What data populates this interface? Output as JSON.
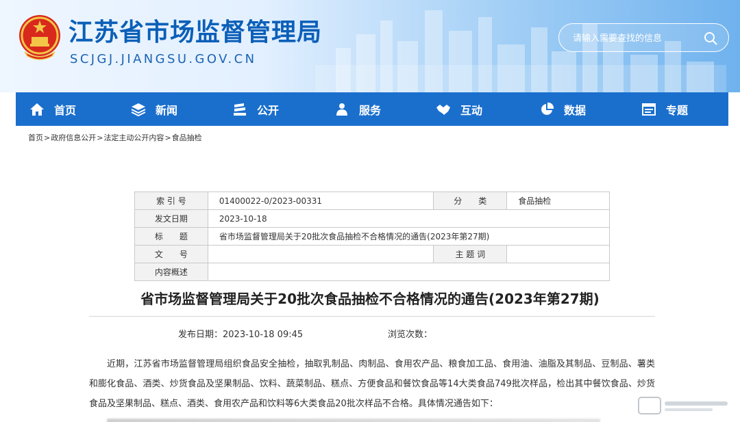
{
  "header": {
    "site_title": "江苏省市场监督管理局",
    "site_domain": "SCJGJ.JIANGSU.GOV.CN",
    "search_placeholder": "请输入需要查找的信息"
  },
  "nav": {
    "items": [
      {
        "label": "首页",
        "icon": "home-icon"
      },
      {
        "label": "新闻",
        "icon": "layers-icon"
      },
      {
        "label": "公开",
        "icon": "publish-icon"
      },
      {
        "label": "服务",
        "icon": "users-icon"
      },
      {
        "label": "互动",
        "icon": "handshake-icon"
      },
      {
        "label": "数据",
        "icon": "pie-chart-icon"
      },
      {
        "label": "专题",
        "icon": "window-icon"
      }
    ]
  },
  "breadcrumb": [
    "首页",
    "政府信息公开",
    "法定主动公开内容",
    "食品抽检"
  ],
  "info": {
    "index_label": "索 引 号",
    "index_value": "01400022-0/2023-00331",
    "category_label": "分　　类",
    "category_value": "食品抽检",
    "date_label": "发文日期",
    "date_value": "2023-10-18",
    "title_label": "标　　题",
    "title_value": "省市场监督管理局关于20批次食品抽检不合格情况的通告(2023年第27期)",
    "docno_label": "文　　号",
    "docno_value": "",
    "keywords_label": "主 题 词",
    "keywords_value": "",
    "summary_label": "内容概述",
    "summary_value": ""
  },
  "article": {
    "title": "省市场监督管理局关于20批次食品抽检不合格情况的通告(2023年第27期)",
    "publish_date": "发布日期：2023-10-18 09:45",
    "views": "浏览次数：",
    "body": "近期，江苏省市场监督管理局组织食品安全抽检，抽取乳制品、肉制品、食用农产品、粮食加工品、食用油、油脂及其制品、豆制品、薯类和膨化食品、酒类、炒货食品及坚果制品、饮料、蔬菜制品、糕点、方便食品和餐饮食品等14大类食品749批次样品，检出其中餐饮食品、炒货食品及坚果制品、糕点、酒类、食用农产品和饮料等6大类食品20批次样品不合格。具体情况通告如下："
  },
  "colors": {
    "nav_bg": "#1a6fcd",
    "title_blue": "#0b5fb8"
  }
}
